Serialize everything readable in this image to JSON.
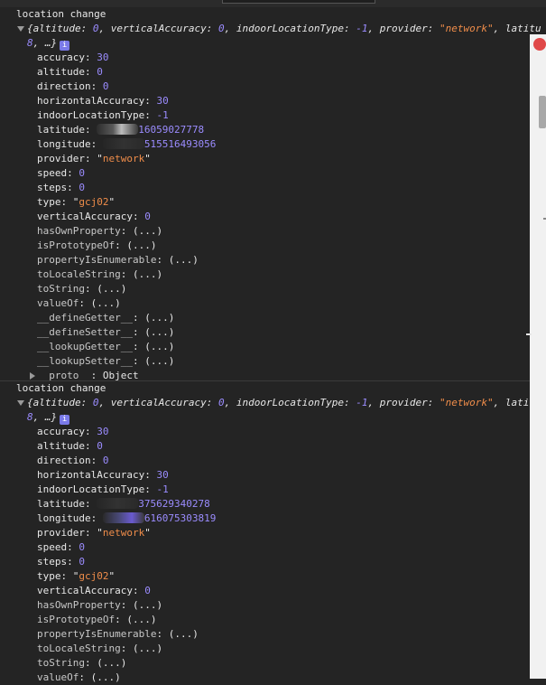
{
  "logs": [
    {
      "title": "location change",
      "summary_open": "{",
      "summary_props": [
        {
          "key": "altitude",
          "value": "0",
          "type": "num"
        },
        {
          "key": "verticalAccuracy",
          "value": "0",
          "type": "num"
        },
        {
          "key": "indoorLocationType",
          "value": "-1",
          "type": "num"
        },
        {
          "key": "provider",
          "value": "\"network\"",
          "type": "str"
        }
      ],
      "summary_tail": "latitu",
      "summary_line2_num": "8",
      "summary_line2_rest": ", …}",
      "info_glyph": "i",
      "props": {
        "accuracy": "30",
        "altitude": "0",
        "direction": "0",
        "horizontalAccuracy": "30",
        "indoorLocationType": "-1",
        "latitude": "16059027778",
        "longitude": "515516493056",
        "provider": "network",
        "speed": "0",
        "steps": "0",
        "type": "gcj02",
        "verticalAccuracy": "0"
      },
      "proto": {
        "hasOwnProperty": "(...)",
        "isPrototypeOf": "(...)",
        "propertyIsEnumerable": "(...)",
        "toLocaleString": "(...)",
        "toString": "(...)",
        "valueOf": "(...)",
        "defineGetter": "(...)",
        "defineSetter": "(...)",
        "lookupGetter": "(...)",
        "lookupSetter": "(...)",
        "proto_key": "__proto__",
        "proto_value": "Object"
      }
    },
    {
      "title": "location change",
      "summary_open": "{",
      "summary_props": [
        {
          "key": "altitude",
          "value": "0",
          "type": "num"
        },
        {
          "key": "verticalAccuracy",
          "value": "0",
          "type": "num"
        },
        {
          "key": "indoorLocationType",
          "value": "-1",
          "type": "num"
        },
        {
          "key": "provider",
          "value": "\"network\"",
          "type": "str"
        }
      ],
      "summary_tail": "latit",
      "summary_line2_num": "8",
      "summary_line2_rest": ", …}",
      "info_glyph": "i",
      "props": {
        "accuracy": "30",
        "altitude": "0",
        "direction": "0",
        "horizontalAccuracy": "30",
        "indoorLocationType": "-1",
        "latitude": "375629340278",
        "longitude": "616075303819",
        "provider": "network",
        "speed": "0",
        "steps": "0",
        "type": "gcj02",
        "verticalAccuracy": "0"
      },
      "proto": {
        "hasOwnProperty": "(...)",
        "isPrototypeOf": "(...)",
        "propertyIsEnumerable": "(...)",
        "toLocaleString": "(...)",
        "toString": "(...)",
        "valueOf": "(...)"
      }
    }
  ],
  "keys": {
    "accuracy": "accuracy",
    "altitude": "altitude",
    "direction": "direction",
    "horizontalAccuracy": "horizontalAccuracy",
    "indoorLocationType": "indoorLocationType",
    "latitude": "latitude",
    "longitude": "longitude",
    "provider": "provider",
    "speed": "speed",
    "steps": "steps",
    "type": "type",
    "verticalAccuracy": "verticalAccuracy",
    "hasOwnProperty": "hasOwnProperty",
    "isPrototypeOf": "isPrototypeOf",
    "propertyIsEnumerable": "propertyIsEnumerable",
    "toLocaleString": "toLocaleString",
    "toString": "toString",
    "valueOf": "valueOf",
    "defineGetter": "__defineGetter__",
    "defineSetter": "__defineSetter__",
    "lookupGetter": "__lookupGetter__",
    "lookupSetter": "__lookupSetter__"
  },
  "colors": {
    "number": "#9b8cff",
    "string": "#f08d4a",
    "background": "#242424"
  }
}
